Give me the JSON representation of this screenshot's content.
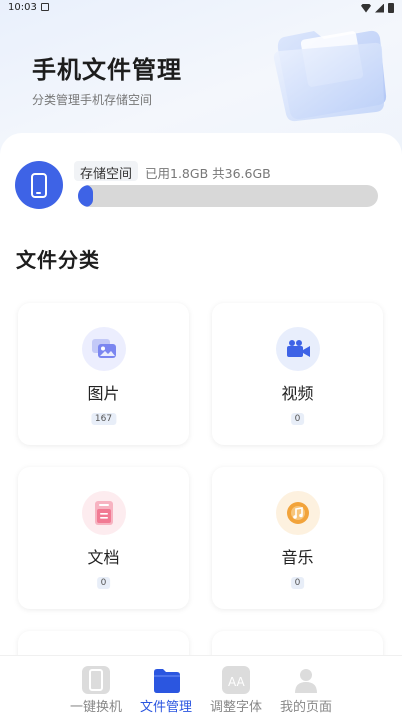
{
  "status_bar": {
    "time": "10:03"
  },
  "header": {
    "title": "手机文件管理",
    "subtitle": "分类管理手机存储空间"
  },
  "storage": {
    "label": "存储空间",
    "usage_text": "已用1.8GB 共36.6GB",
    "used_fraction": 0.05,
    "accent_color": "#3e63e6"
  },
  "categories": {
    "title": "文件分类",
    "items": [
      {
        "label": "图片",
        "count": "167",
        "icon": "image-icon",
        "color": "#7b86f0"
      },
      {
        "label": "视频",
        "count": "0",
        "icon": "video-camera-icon",
        "color": "#3e63e6"
      },
      {
        "label": "文档",
        "count": "0",
        "icon": "document-icon",
        "color": "#f17a93"
      },
      {
        "label": "音乐",
        "count": "0",
        "icon": "music-icon",
        "color": "#f2a33a"
      }
    ]
  },
  "bottom_nav": {
    "items": [
      {
        "label": "一键换机",
        "icon": "phone-transfer-icon",
        "active": false
      },
      {
        "label": "文件管理",
        "icon": "folder-icon",
        "active": true
      },
      {
        "label": "调整字体",
        "icon": "font-size-icon",
        "active": false
      },
      {
        "label": "我的页面",
        "icon": "person-icon",
        "active": false
      }
    ]
  }
}
